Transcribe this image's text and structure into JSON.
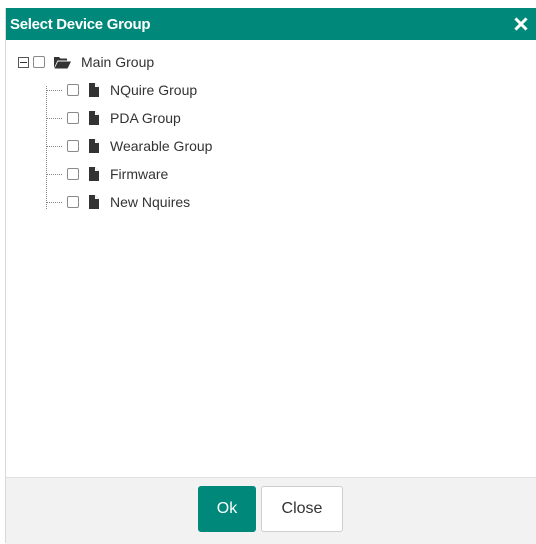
{
  "dialog": {
    "title": "Select Device Group",
    "close_icon": "close-icon"
  },
  "tree": {
    "root": {
      "label": "Main Group",
      "icon": "folder-open-icon",
      "expanded": true,
      "checked": false
    },
    "children": [
      {
        "label": "NQuire Group",
        "icon": "file-icon",
        "checked": false
      },
      {
        "label": "PDA Group",
        "icon": "file-icon",
        "checked": false
      },
      {
        "label": "Wearable Group",
        "icon": "file-icon",
        "checked": false
      },
      {
        "label": "Firmware",
        "icon": "file-icon",
        "checked": false
      },
      {
        "label": "New Nquires",
        "icon": "file-icon",
        "checked": false
      }
    ]
  },
  "footer": {
    "ok_label": "Ok",
    "close_label": "Close"
  },
  "colors": {
    "accent": "#00897b",
    "footer_bg": "#f2f2f2"
  }
}
